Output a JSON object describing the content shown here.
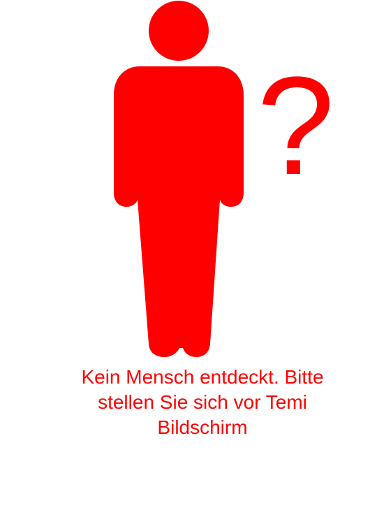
{
  "status": {
    "icon": "person-unknown-icon",
    "question_mark": "?",
    "message": "Kein Mensch entdeckt. Bitte stellen Sie sich vor Temi Bildschirm"
  },
  "colors": {
    "accent": "#ff0000",
    "background": "#ffffff"
  }
}
